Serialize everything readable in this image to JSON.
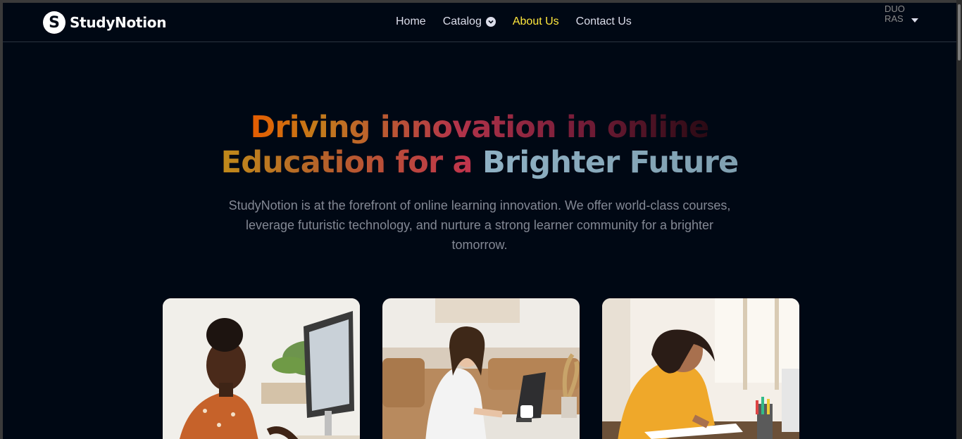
{
  "brand": {
    "name": "StudyNotion",
    "logo_letter": "S"
  },
  "nav": {
    "items": [
      {
        "label": "Home",
        "active": false
      },
      {
        "label": "Catalog",
        "active": false,
        "dropdown": true
      },
      {
        "label": "About Us",
        "active": true
      },
      {
        "label": "Contact Us",
        "active": false
      }
    ]
  },
  "profile": {
    "avatar_alt": "DUO RAS"
  },
  "hero": {
    "line1_a": "Driving innovation in online",
    "line2_a": "Education for a ",
    "line2_b": "Brighter Future",
    "description": "StudyNotion is at the forefront of online learning innovation. We offer world-class courses, leverage futuristic technology, and nurture a strong learner community for a brighter tomorrow."
  },
  "colors": {
    "background": "#000814",
    "active_link": "#FFE83D",
    "text": "#DBDDEA",
    "muted": "#838894"
  }
}
